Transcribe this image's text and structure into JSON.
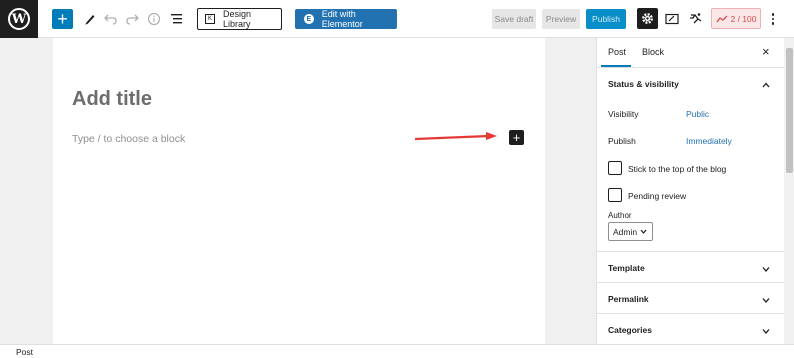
{
  "toolbar": {
    "logo_letter": "W",
    "design_library_label": "Design Library",
    "elementor_label": "Edit with Elementor",
    "elementor_icon_letter": "E",
    "save_draft_label": "Save draft",
    "preview_label": "Preview",
    "publish_label": "Publish",
    "score_label": "2 / 100",
    "icons": [
      "wordpress-logo",
      "plus-icon",
      "pencil-icon",
      "undo-icon",
      "redo-icon",
      "info-icon",
      "list-view-icon",
      "library-icon",
      "elementor-icon",
      "gear-icon",
      "preview-device-icon",
      "runner-icon",
      "score-icon",
      "more-vertical-icon"
    ]
  },
  "editor": {
    "title_placeholder": "Add title",
    "block_placeholder": "Type / to choose a block"
  },
  "sidebar": {
    "tabs": [
      {
        "label": "Post",
        "active": true
      },
      {
        "label": "Block",
        "active": false
      }
    ],
    "status_visibility": {
      "heading": "Status & visibility",
      "visibility_label": "Visibility",
      "visibility_value": "Public",
      "publish_label": "Publish",
      "publish_value": "Immediately",
      "stick_label": "Stick to the top of the blog",
      "pending_label": "Pending review",
      "author_label": "Author",
      "author_value": "Admin"
    },
    "panels": [
      "Template",
      "Permalink",
      "Categories"
    ]
  },
  "footer": {
    "breadcrumb": "Post"
  },
  "colors": {
    "accent": "#007cba",
    "elementor": "#2271b1",
    "link": "#2271b1",
    "score_bg": "#fbe7e7",
    "score_text": "#d94c4c",
    "annotation_arrow": "#e53935"
  }
}
